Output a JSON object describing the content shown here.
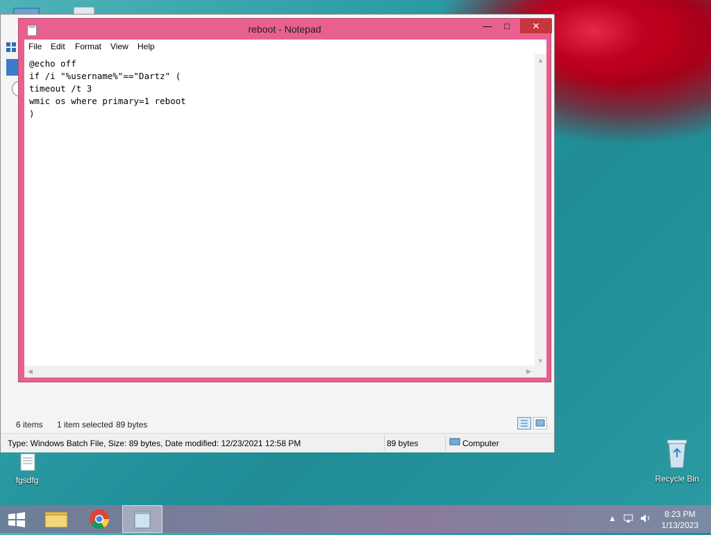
{
  "notepad": {
    "title": "reboot - Notepad",
    "controls": {
      "minimize": "—",
      "maximize": "□",
      "close": "✕"
    },
    "menu": [
      "File",
      "Edit",
      "Format",
      "View",
      "Help"
    ],
    "content": "@echo off\nif /i \"%username%\"==\"Dartz\" (\ntimeout /t 3\nwmic os where primary=1 reboot\n)"
  },
  "explorer": {
    "status": {
      "items": "6 items",
      "selected": "1 item selected",
      "size": "89 bytes"
    },
    "details": {
      "info": "Type: Windows Batch File, Size: 89 bytes, Date modified: 12/23/2021 12:58 PM",
      "size": "89 bytes",
      "location": "Computer"
    }
  },
  "desktop": {
    "icons": [
      {
        "label": "fgsdfg"
      },
      {
        "label": "Recycle Bin"
      }
    ]
  },
  "taskbar": {
    "clock": {
      "time": "8:23 PM",
      "date": "1/13/2023"
    },
    "apps": [
      "file-explorer",
      "chrome",
      "notepad"
    ]
  }
}
